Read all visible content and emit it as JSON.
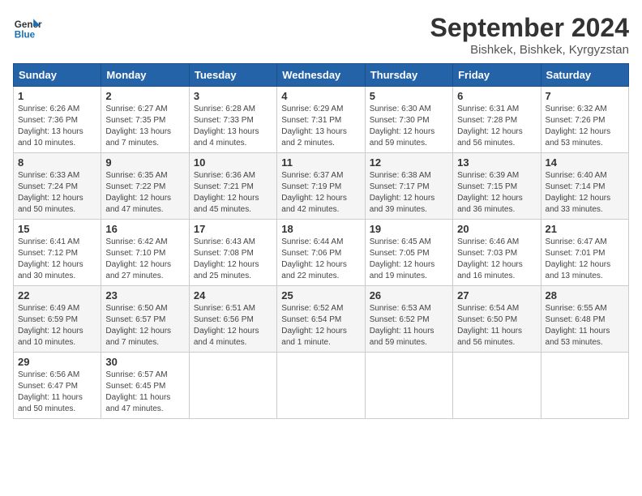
{
  "header": {
    "logo_line1": "General",
    "logo_line2": "Blue",
    "month_title": "September 2024",
    "subtitle": "Bishkek, Bishkek, Kyrgyzstan"
  },
  "weekdays": [
    "Sunday",
    "Monday",
    "Tuesday",
    "Wednesday",
    "Thursday",
    "Friday",
    "Saturday"
  ],
  "weeks": [
    [
      {
        "day": "1",
        "sunrise": "6:26 AM",
        "sunset": "7:36 PM",
        "daylight": "13 hours and 10 minutes."
      },
      {
        "day": "2",
        "sunrise": "6:27 AM",
        "sunset": "7:35 PM",
        "daylight": "13 hours and 7 minutes."
      },
      {
        "day": "3",
        "sunrise": "6:28 AM",
        "sunset": "7:33 PM",
        "daylight": "13 hours and 4 minutes."
      },
      {
        "day": "4",
        "sunrise": "6:29 AM",
        "sunset": "7:31 PM",
        "daylight": "13 hours and 2 minutes."
      },
      {
        "day": "5",
        "sunrise": "6:30 AM",
        "sunset": "7:30 PM",
        "daylight": "12 hours and 59 minutes."
      },
      {
        "day": "6",
        "sunrise": "6:31 AM",
        "sunset": "7:28 PM",
        "daylight": "12 hours and 56 minutes."
      },
      {
        "day": "7",
        "sunrise": "6:32 AM",
        "sunset": "7:26 PM",
        "daylight": "12 hours and 53 minutes."
      }
    ],
    [
      {
        "day": "8",
        "sunrise": "6:33 AM",
        "sunset": "7:24 PM",
        "daylight": "12 hours and 50 minutes."
      },
      {
        "day": "9",
        "sunrise": "6:35 AM",
        "sunset": "7:22 PM",
        "daylight": "12 hours and 47 minutes."
      },
      {
        "day": "10",
        "sunrise": "6:36 AM",
        "sunset": "7:21 PM",
        "daylight": "12 hours and 45 minutes."
      },
      {
        "day": "11",
        "sunrise": "6:37 AM",
        "sunset": "7:19 PM",
        "daylight": "12 hours and 42 minutes."
      },
      {
        "day": "12",
        "sunrise": "6:38 AM",
        "sunset": "7:17 PM",
        "daylight": "12 hours and 39 minutes."
      },
      {
        "day": "13",
        "sunrise": "6:39 AM",
        "sunset": "7:15 PM",
        "daylight": "12 hours and 36 minutes."
      },
      {
        "day": "14",
        "sunrise": "6:40 AM",
        "sunset": "7:14 PM",
        "daylight": "12 hours and 33 minutes."
      }
    ],
    [
      {
        "day": "15",
        "sunrise": "6:41 AM",
        "sunset": "7:12 PM",
        "daylight": "12 hours and 30 minutes."
      },
      {
        "day": "16",
        "sunrise": "6:42 AM",
        "sunset": "7:10 PM",
        "daylight": "12 hours and 27 minutes."
      },
      {
        "day": "17",
        "sunrise": "6:43 AM",
        "sunset": "7:08 PM",
        "daylight": "12 hours and 25 minutes."
      },
      {
        "day": "18",
        "sunrise": "6:44 AM",
        "sunset": "7:06 PM",
        "daylight": "12 hours and 22 minutes."
      },
      {
        "day": "19",
        "sunrise": "6:45 AM",
        "sunset": "7:05 PM",
        "daylight": "12 hours and 19 minutes."
      },
      {
        "day": "20",
        "sunrise": "6:46 AM",
        "sunset": "7:03 PM",
        "daylight": "12 hours and 16 minutes."
      },
      {
        "day": "21",
        "sunrise": "6:47 AM",
        "sunset": "7:01 PM",
        "daylight": "12 hours and 13 minutes."
      }
    ],
    [
      {
        "day": "22",
        "sunrise": "6:49 AM",
        "sunset": "6:59 PM",
        "daylight": "12 hours and 10 minutes."
      },
      {
        "day": "23",
        "sunrise": "6:50 AM",
        "sunset": "6:57 PM",
        "daylight": "12 hours and 7 minutes."
      },
      {
        "day": "24",
        "sunrise": "6:51 AM",
        "sunset": "6:56 PM",
        "daylight": "12 hours and 4 minutes."
      },
      {
        "day": "25",
        "sunrise": "6:52 AM",
        "sunset": "6:54 PM",
        "daylight": "12 hours and 1 minute."
      },
      {
        "day": "26",
        "sunrise": "6:53 AM",
        "sunset": "6:52 PM",
        "daylight": "11 hours and 59 minutes."
      },
      {
        "day": "27",
        "sunrise": "6:54 AM",
        "sunset": "6:50 PM",
        "daylight": "11 hours and 56 minutes."
      },
      {
        "day": "28",
        "sunrise": "6:55 AM",
        "sunset": "6:48 PM",
        "daylight": "11 hours and 53 minutes."
      }
    ],
    [
      {
        "day": "29",
        "sunrise": "6:56 AM",
        "sunset": "6:47 PM",
        "daylight": "11 hours and 50 minutes."
      },
      {
        "day": "30",
        "sunrise": "6:57 AM",
        "sunset": "6:45 PM",
        "daylight": "11 hours and 47 minutes."
      },
      null,
      null,
      null,
      null,
      null
    ]
  ]
}
